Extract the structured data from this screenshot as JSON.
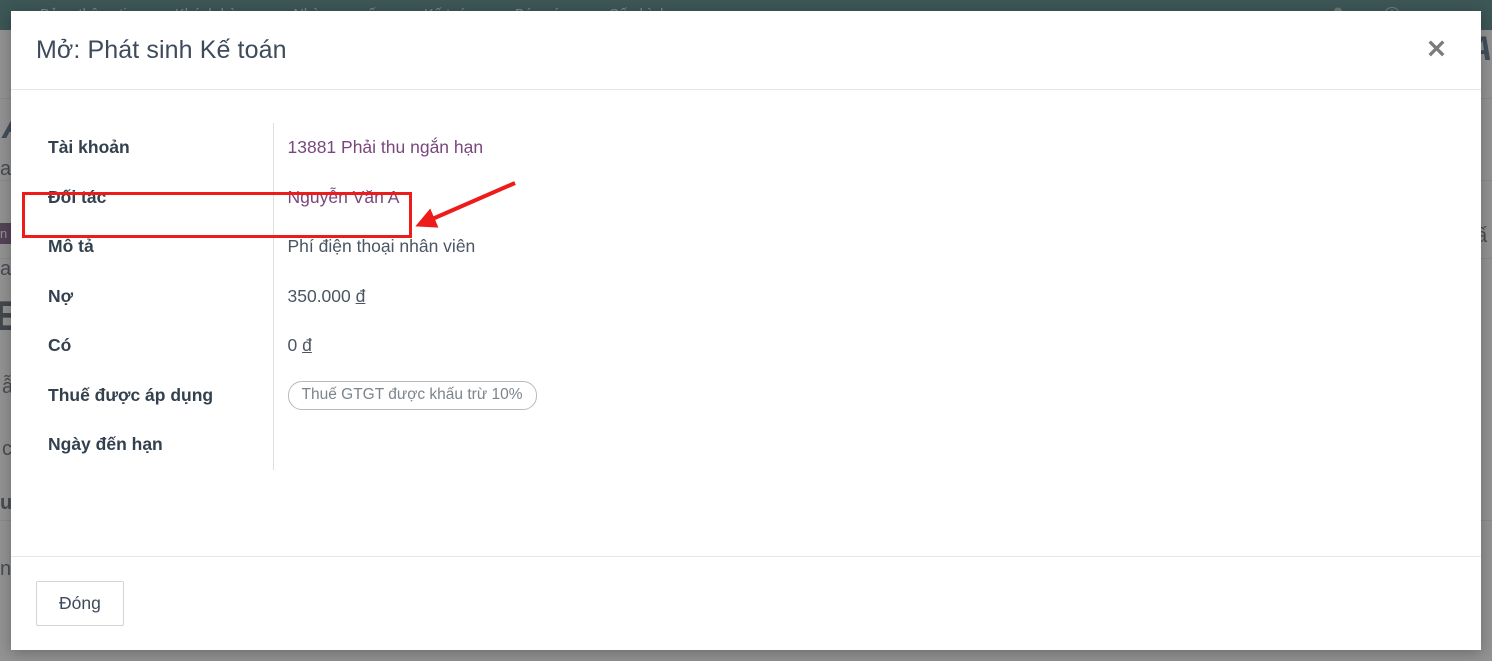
{
  "background_app": {
    "nav": {
      "items": [
        {
          "label": "Bảng thông tin",
          "name": "nav-dashboard"
        },
        {
          "label": "Khách hàng",
          "name": "nav-customers"
        },
        {
          "label": "Nhà cung cấp",
          "name": "nav-suppliers"
        },
        {
          "label": "Kế toán",
          "name": "nav-accounting"
        },
        {
          "label": "Báo cáo",
          "name": "nav-reports"
        },
        {
          "label": "Cấu hình",
          "name": "nav-settings"
        }
      ],
      "right_icons": [
        "bell-icon",
        "power-icon"
      ],
      "background_color": "#1e5f60"
    },
    "fragments": {
      "logo_letter": "A",
      "frag_1": "ac",
      "frag_2": "a",
      "frag_3": "E",
      "frag_4": "ẫ",
      "frag_5": "c",
      "frag_6": "u",
      "frag_7": "ng",
      "chip": "n t",
      "right_frag": "ấ"
    }
  },
  "modal": {
    "title": "Mở: Phát sinh Kế toán",
    "close_icon_label": "✕",
    "rows": [
      {
        "label": "Tài khoản",
        "value": "13881 Phải thu ngắn hạn",
        "kind": "link",
        "name": "row-account"
      },
      {
        "label": "Đối tác",
        "value": "Nguyễn Văn A",
        "kind": "link",
        "name": "row-partner"
      },
      {
        "label": "Mô tả",
        "value": "Phí điện thoại nhân viên",
        "kind": "text",
        "name": "row-description"
      },
      {
        "label": "Nợ",
        "value": "350.000",
        "currency": "đ",
        "kind": "money",
        "name": "row-debit"
      },
      {
        "label": "Có",
        "value": "0",
        "currency": "đ",
        "kind": "money",
        "name": "row-credit"
      },
      {
        "label": "Thuế được áp dụng",
        "value": "Thuế GTGT được khấu trừ 10%",
        "kind": "badge",
        "name": "row-tax"
      },
      {
        "label": "Ngày đến hạn",
        "value": "",
        "kind": "text",
        "name": "row-due-date"
      }
    ],
    "footer": {
      "close_button_label": "Đóng"
    }
  },
  "annotation": {
    "highlight_color": "#ee1b1b",
    "target_row_label": "Đối tác",
    "target_row_value": "Nguyễn Văn A"
  },
  "colors": {
    "nav_bg": "#1e5f60",
    "link": "#79477d",
    "label": "#33414f",
    "value": "#4a5663",
    "annotation_red": "#ee1b1b",
    "backdrop": "rgba(80,80,80,0.62)"
  }
}
